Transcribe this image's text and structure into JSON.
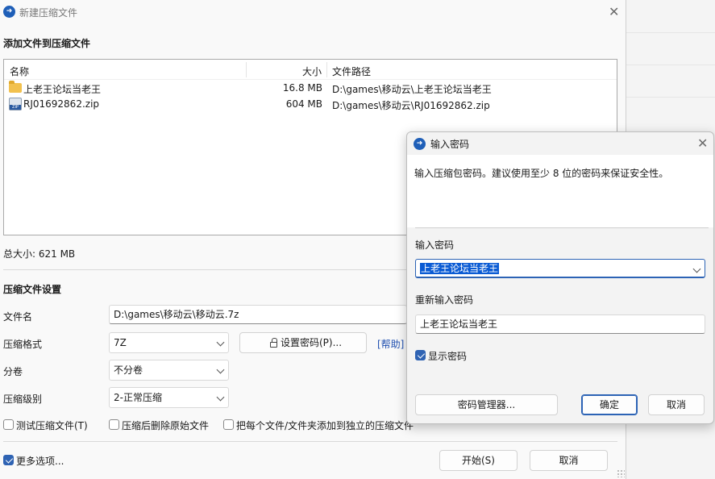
{
  "main_dialog": {
    "title": "新建压缩文件",
    "add_files_section": "添加文件到压缩文件",
    "columns": {
      "name": "名称",
      "size": "大小",
      "path": "文件路径"
    },
    "files": [
      {
        "name": "上老王论坛当老王",
        "size": "16.8 MB",
        "path": "D:\\games\\移动云\\上老王论坛当老王",
        "icon": "folder-icon"
      },
      {
        "name": "RJ01692862.zip",
        "size": "604 MB",
        "path": "D:\\games\\移动云\\RJ01692862.zip",
        "icon": "zip-icon"
      }
    ],
    "total_size": "总大小: 621 MB",
    "settings_section": "压缩文件设置",
    "filename_label": "文件名",
    "filename_value": "D:\\games\\移动云\\移动云.7z",
    "format_label": "压缩格式",
    "format_value": "7Z",
    "set_password_button": "设置密码(P)...",
    "help_link": "[帮助]",
    "split_label": "分卷",
    "split_value": "不分卷",
    "level_label": "压缩级别",
    "level_value": "2-正常压缩",
    "checkbox_test": "测试压缩文件(T)",
    "checkbox_delete": "压缩后删除原始文件",
    "checkbox_separate": "把每个文件/文件夹添加到独立的压缩文件",
    "more_options": "更多选项...",
    "start_button": "开始(S)",
    "cancel_button": "取消"
  },
  "password_dialog": {
    "title": "输入密码",
    "description": "输入压缩包密码。建议使用至少 8 位的密码来保证安全性。",
    "password_label": "输入密码",
    "password_value": "上老王论坛当老王",
    "reenter_label": "重新输入密码",
    "reenter_value": "上老王论坛当老王",
    "show_password": "显示密码",
    "manager_button": "密码管理器...",
    "ok_button": "确定",
    "cancel_button": "取消"
  }
}
